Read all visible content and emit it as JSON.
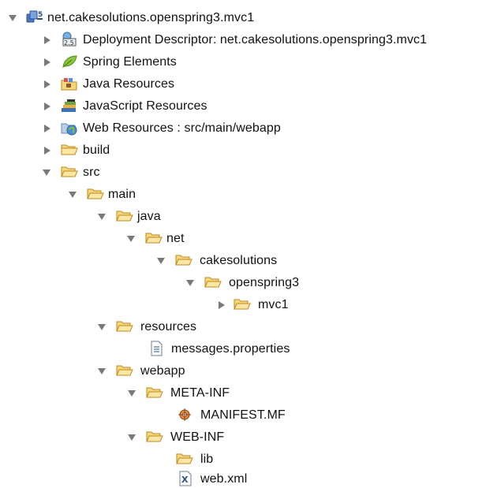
{
  "tree": {
    "root": {
      "label": "net.cakesolutions.openspring3.mvc1",
      "icon": "project-icon",
      "expanded": true
    },
    "items": [
      {
        "label": "Deployment Descriptor: net.cakesolutions.openspring3.mvc1",
        "icon": "deployment-descriptor-icon",
        "expanded": false
      },
      {
        "label": "Spring Elements",
        "icon": "spring-leaf-icon",
        "expanded": false
      },
      {
        "label": "Java Resources",
        "icon": "java-resources-icon",
        "expanded": false
      },
      {
        "label": "JavaScript Resources",
        "icon": "javascript-resources-icon",
        "expanded": false
      },
      {
        "label": "Web Resources : src/main/webapp",
        "icon": "web-resources-icon",
        "expanded": false
      },
      {
        "label": "build",
        "icon": "folder-icon",
        "expanded": false
      },
      {
        "label": "src",
        "icon": "folder-open-icon",
        "expanded": true
      },
      {
        "label": "main",
        "icon": "folder-open-icon",
        "expanded": true
      },
      {
        "label": "java",
        "icon": "folder-open-icon",
        "expanded": true
      },
      {
        "label": "net",
        "icon": "folder-open-icon",
        "expanded": true
      },
      {
        "label": "cakesolutions",
        "icon": "folder-open-icon",
        "expanded": true
      },
      {
        "label": "openspring3",
        "icon": "folder-open-icon",
        "expanded": true
      },
      {
        "label": "mvc1",
        "icon": "folder-icon",
        "expanded": false
      },
      {
        "label": "resources",
        "icon": "folder-open-icon",
        "expanded": true
      },
      {
        "label": "messages.properties",
        "icon": "properties-file-icon"
      },
      {
        "label": "webapp",
        "icon": "folder-open-icon",
        "expanded": true
      },
      {
        "label": "META-INF",
        "icon": "folder-open-icon",
        "expanded": true
      },
      {
        "label": "MANIFEST.MF",
        "icon": "manifest-file-icon"
      },
      {
        "label": "WEB-INF",
        "icon": "folder-open-icon",
        "expanded": true
      },
      {
        "label": "lib",
        "icon": "folder-icon"
      },
      {
        "label": "web.xml",
        "icon": "xml-file-icon"
      }
    ]
  },
  "colors": {
    "arrow": "#7a7a7a",
    "folder_fill": "#f6d77b",
    "folder_stroke": "#c08a1e",
    "text": "#111111",
    "background": "#ffffff"
  }
}
